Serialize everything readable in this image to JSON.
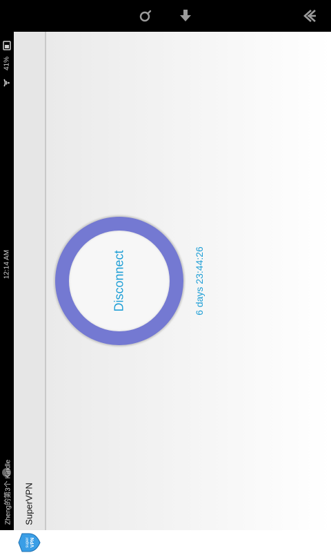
{
  "status_bar": {
    "notification_text": "Zheng的第3个 Kindle",
    "notification_count": "1",
    "time": "12:14 AM",
    "battery": "41%",
    "icons": [
      "notification-badge-icon",
      "wifi-icon",
      "battery-icon"
    ]
  },
  "nav_bar": {
    "icons": [
      "search-icon",
      "download-icon",
      "back-icon"
    ]
  },
  "app_bar": {
    "title": "SuperVPN",
    "logo_text_top": "super",
    "logo_text_bottom": "VPN"
  },
  "main": {
    "button_label": "Disconnect",
    "elapsed_time": "6 days 23:44:26"
  },
  "colors": {
    "ring": "#7479d2",
    "accent_text": "#1f9fd6",
    "app_bar_bg": "#e6e6e6",
    "system_bar_bg": "#000000"
  }
}
